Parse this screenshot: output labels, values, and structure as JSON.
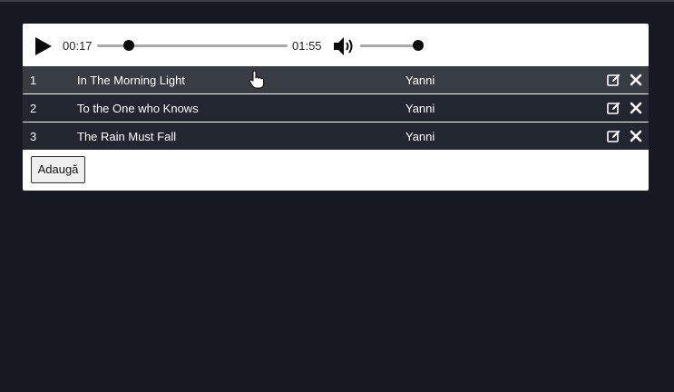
{
  "player": {
    "current_time": "00:17",
    "duration": "01:55",
    "progress_fraction": 0.15,
    "volume_fraction": 1.0
  },
  "playlist": [
    {
      "index": "1",
      "title": "In The Morning Light",
      "artist": "Yanni"
    },
    {
      "index": "2",
      "title": "To the One who Knows",
      "artist": "Yanni"
    },
    {
      "index": "3",
      "title": "The Rain Must Fall",
      "artist": "Yanni"
    }
  ],
  "actions": {
    "add_label": "Adaugă"
  },
  "icons": {
    "play": "play-icon",
    "volume": "volume-icon",
    "edit": "edit-icon",
    "delete": "close-icon"
  },
  "colors": {
    "background": "#161922",
    "row": "#212631",
    "row_hover": "#383c43",
    "track": "#a9a9a9"
  }
}
